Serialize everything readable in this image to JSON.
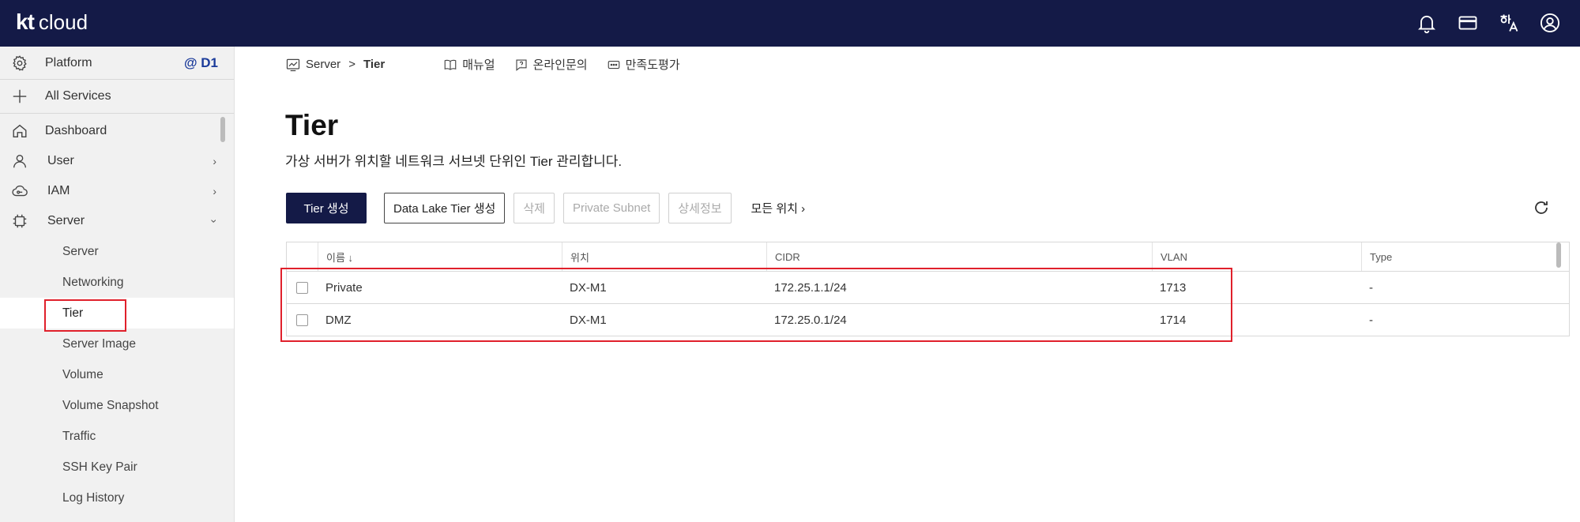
{
  "app": {
    "logo_kt": "kt",
    "logo_cloud": "cloud"
  },
  "topbar": {
    "icons": [
      "bell-icon",
      "card-icon",
      "language-icon",
      "user-circle-icon"
    ]
  },
  "sidebar": {
    "platform_label": "Platform",
    "platform_badge": "@ D1",
    "all_services": "All Services",
    "items": [
      {
        "label": "Dashboard"
      },
      {
        "label": "User"
      },
      {
        "label": "IAM"
      },
      {
        "label": "Server"
      }
    ],
    "server_sub": [
      {
        "label": "Server"
      },
      {
        "label": "Networking"
      },
      {
        "label": "Tier"
      },
      {
        "label": "Server Image"
      },
      {
        "label": "Volume"
      },
      {
        "label": "Volume Snapshot"
      },
      {
        "label": "Traffic"
      },
      {
        "label": "SSH Key Pair"
      },
      {
        "label": "Log History"
      }
    ]
  },
  "breadcrumb": {
    "parent": "Server",
    "separator": ">",
    "current": "Tier",
    "links": [
      "매뉴얼",
      "온라인문의",
      "만족도평가"
    ]
  },
  "page": {
    "title": "Tier",
    "description": "가상 서버가 위치할 네트워크 서브넷 단위인 Tier 관리합니다."
  },
  "actions": {
    "create": "Tier 생성",
    "create_datalake": "Data Lake Tier 생성",
    "delete": "삭제",
    "private_subnet": "Private Subnet",
    "detail": "상세정보",
    "location": "모든 위치 ›"
  },
  "table": {
    "headers": {
      "name": "이름 ↓",
      "location": "위치",
      "cidr": "CIDR",
      "vlan": "VLAN",
      "type": "Type"
    },
    "rows": [
      {
        "name": "Private",
        "location": "DX-M1",
        "cidr": "172.25.1.1/24",
        "vlan": "1713",
        "type": "-"
      },
      {
        "name": "DMZ",
        "location": "DX-M1",
        "cidr": "172.25.0.1/24",
        "vlan": "1714",
        "type": "-"
      }
    ]
  }
}
